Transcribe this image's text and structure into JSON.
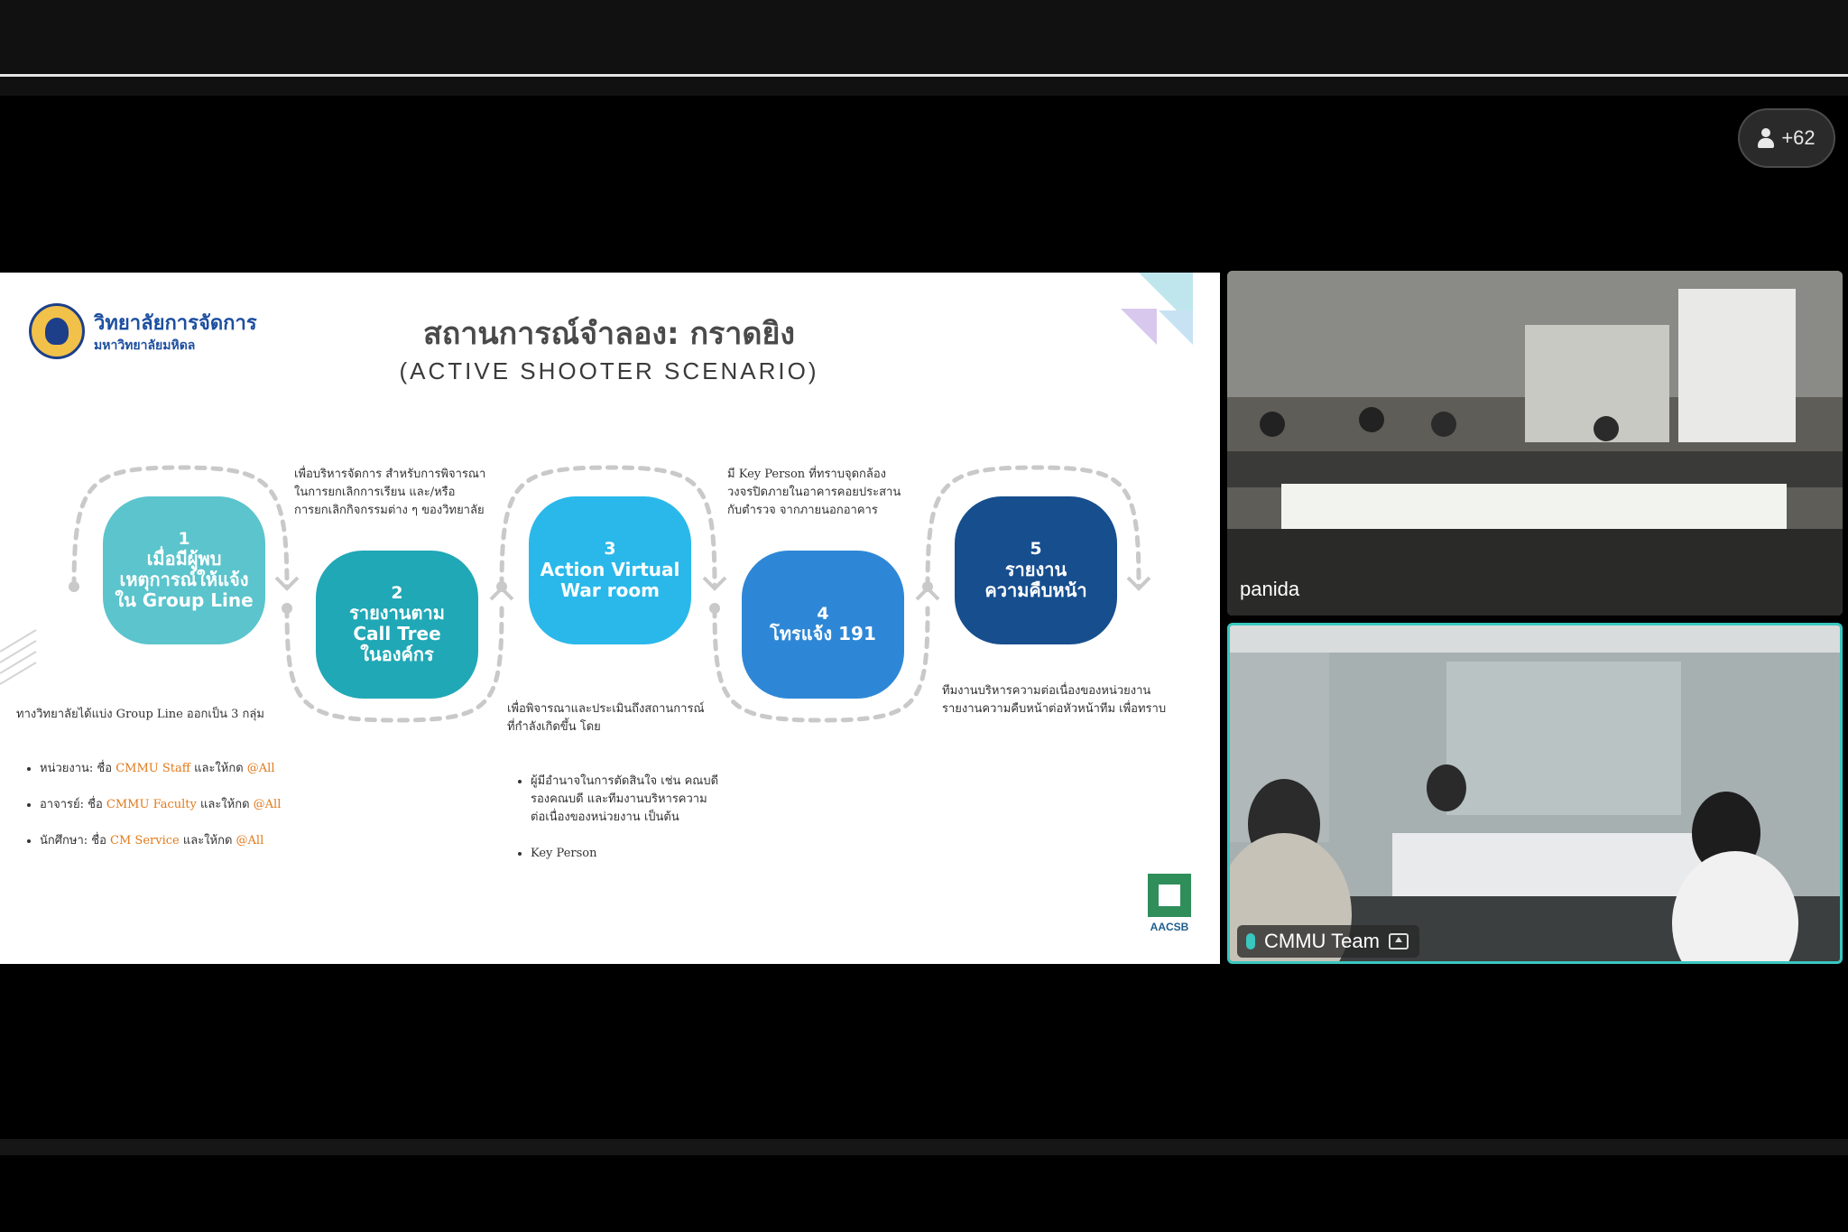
{
  "participants": {
    "count_label": "+62"
  },
  "slide": {
    "logo": {
      "name_th": "วิทยาลัยการจัดการ",
      "sub_th": "มหาวิทยาลัยมหิดล"
    },
    "title": "สถานการณ์จำลอง: กราดยิง",
    "subtitle": "(ACTIVE SHOOTER SCENARIO)",
    "steps": [
      {
        "num": "1",
        "text": "เมื่อมีผู้พบ\nเหตุการณ์ให้แจ้ง\nใน Group Line"
      },
      {
        "num": "2",
        "text": "รายงานตาม\nCall Tree\nในองค์กร"
      },
      {
        "num": "3",
        "text": "Action Virtual\nWar room"
      },
      {
        "num": "4",
        "text": "โทรแจ้ง 191"
      },
      {
        "num": "5",
        "text": "รายงาน\nความคืบหน้า"
      }
    ],
    "notes": {
      "n1_intro": "ทางวิทยาลัยได้แบ่ง Group Line ออกเป็น 3 กลุ่ม",
      "n1_items": [
        {
          "pre": "หน่วยงาน: ชื่อ ",
          "org": "CMMU Staff",
          "mid": " และให้กด ",
          "tag": "@All"
        },
        {
          "pre": "อาจารย์: ชื่อ ",
          "org": "CMMU Faculty",
          "mid": " และให้กด ",
          "tag": "@All"
        },
        {
          "pre": "นักศึกษา: ชื่อ ",
          "org": "CM Service",
          "mid": " และให้กด ",
          "tag": "@All"
        }
      ],
      "n2": "เพื่อบริหารจัดการ สำหรับการพิจารณา\nในการยกเลิกการเรียน และ/หรือ\nการยกเลิกกิจกรรมต่าง ๆ ของวิทยาลัย",
      "n3_intro": "เพื่อพิจารณาและประเมินถึงสถานการณ์\nที่กำลังเกิดขึ้น โดย",
      "n3_items": [
        "ผู้มีอำนาจในการตัดสินใจ เช่น คณบดี\nรองคณบดี และทีมงานบริหารความ\nต่อเนื่องของหน่วยงาน เป็นต้น",
        "Key Person"
      ],
      "n4": "มี Key Person ที่ทราบจุดกล้อง\nวงจรปิดภายในอาคารคอยประสาน\nกับตำรวจ จากภายนอกอาคาร",
      "n5": "ทีมงานบริหารความต่อเนื่องของหน่วยงาน\nรายงานความคืบหน้าต่อหัวหน้าทีม เพื่อทราบ"
    },
    "badge": {
      "text": "AACSB"
    },
    "colors": {
      "step1": "#5bc4cc",
      "step2": "#20a8b6",
      "step3": "#2ab8ea",
      "step4": "#2e87d6",
      "step5": "#164e8e",
      "highlight": "#e07a1c"
    }
  },
  "videos": [
    {
      "name": "panida"
    },
    {
      "name": "CMMU Team"
    }
  ],
  "icons": [
    "person-icon",
    "mic-icon",
    "share-screen-icon"
  ]
}
